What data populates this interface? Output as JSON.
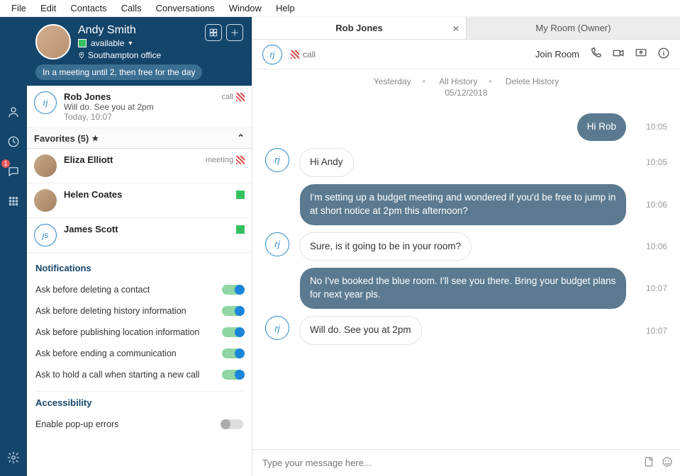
{
  "menu": [
    "File",
    "Edit",
    "Contacts",
    "Calls",
    "Conversations",
    "Window",
    "Help"
  ],
  "profile": {
    "name": "Andy Smith",
    "presence_label": "available",
    "presence_color": "#35c161",
    "location": "Southampton office",
    "status_note": "In a meeting until 2, then free for the day"
  },
  "recent": {
    "name": "Rob Jones",
    "initials": "rj",
    "call_label": "call",
    "preview": "Will do. See you at 2pm",
    "time": "Today, 10:07"
  },
  "favorites": {
    "header": "Favorites (5)",
    "items": [
      {
        "name": "Eliza Elliott",
        "status_label": "meeting",
        "indicator": "hatch",
        "avatar": "img"
      },
      {
        "name": "Helen Coates",
        "status_label": "",
        "indicator": "green",
        "avatar": "img"
      },
      {
        "name": "James Scott",
        "initials": "js",
        "status_label": "",
        "indicator": "green",
        "avatar": "ring"
      }
    ]
  },
  "settings": {
    "notifications_title": "Notifications",
    "notifications": [
      {
        "label": "Ask before deleting a contact",
        "on": true
      },
      {
        "label": "Ask before deleting history information",
        "on": true
      },
      {
        "label": "Ask before publishing location information",
        "on": true
      },
      {
        "label": "Ask before ending a communication",
        "on": true
      },
      {
        "label": "Ask to hold a call when starting a new call",
        "on": true
      }
    ],
    "accessibility_title": "Accessibility",
    "accessibility": [
      {
        "label": "Enable pop-up errors",
        "on": false
      }
    ]
  },
  "tabs": [
    {
      "label": "Rob Jones",
      "active": true,
      "closable": true
    },
    {
      "label": "My Room (Owner)",
      "active": false,
      "closable": false
    }
  ],
  "chat_toolbar": {
    "initials": "rj",
    "call_label": "call",
    "join_label": "Join Room"
  },
  "history": {
    "yesterday": "Yesterday",
    "all": "All History",
    "delete": "Delete History",
    "date": "05/12/2018"
  },
  "messages": [
    {
      "side": "me",
      "time": "10:05",
      "text": "Hi Rob"
    },
    {
      "side": "other",
      "time": "10:05",
      "text": "Hi Andy",
      "initials": "rj",
      "show_avatar": true
    },
    {
      "side": "me",
      "time": "10:06",
      "text": "I'm setting up a budget meeting and wondered if you'd be free to jump in at short notice at 2pm this afternoon?"
    },
    {
      "side": "other",
      "time": "10:06",
      "text": "Sure, is it going to be in your room?",
      "initials": "rj",
      "show_avatar": true
    },
    {
      "side": "me",
      "time": "10:07",
      "text": "No I've booked the blue room. I'll see you there. Bring your budget plans for next year pls."
    },
    {
      "side": "other",
      "time": "10:07",
      "text": "Will do. See you at 2pm",
      "initials": "rj",
      "show_avatar": true
    }
  ],
  "composer": {
    "placeholder": "Type your message here..."
  },
  "nav_badge": "1"
}
